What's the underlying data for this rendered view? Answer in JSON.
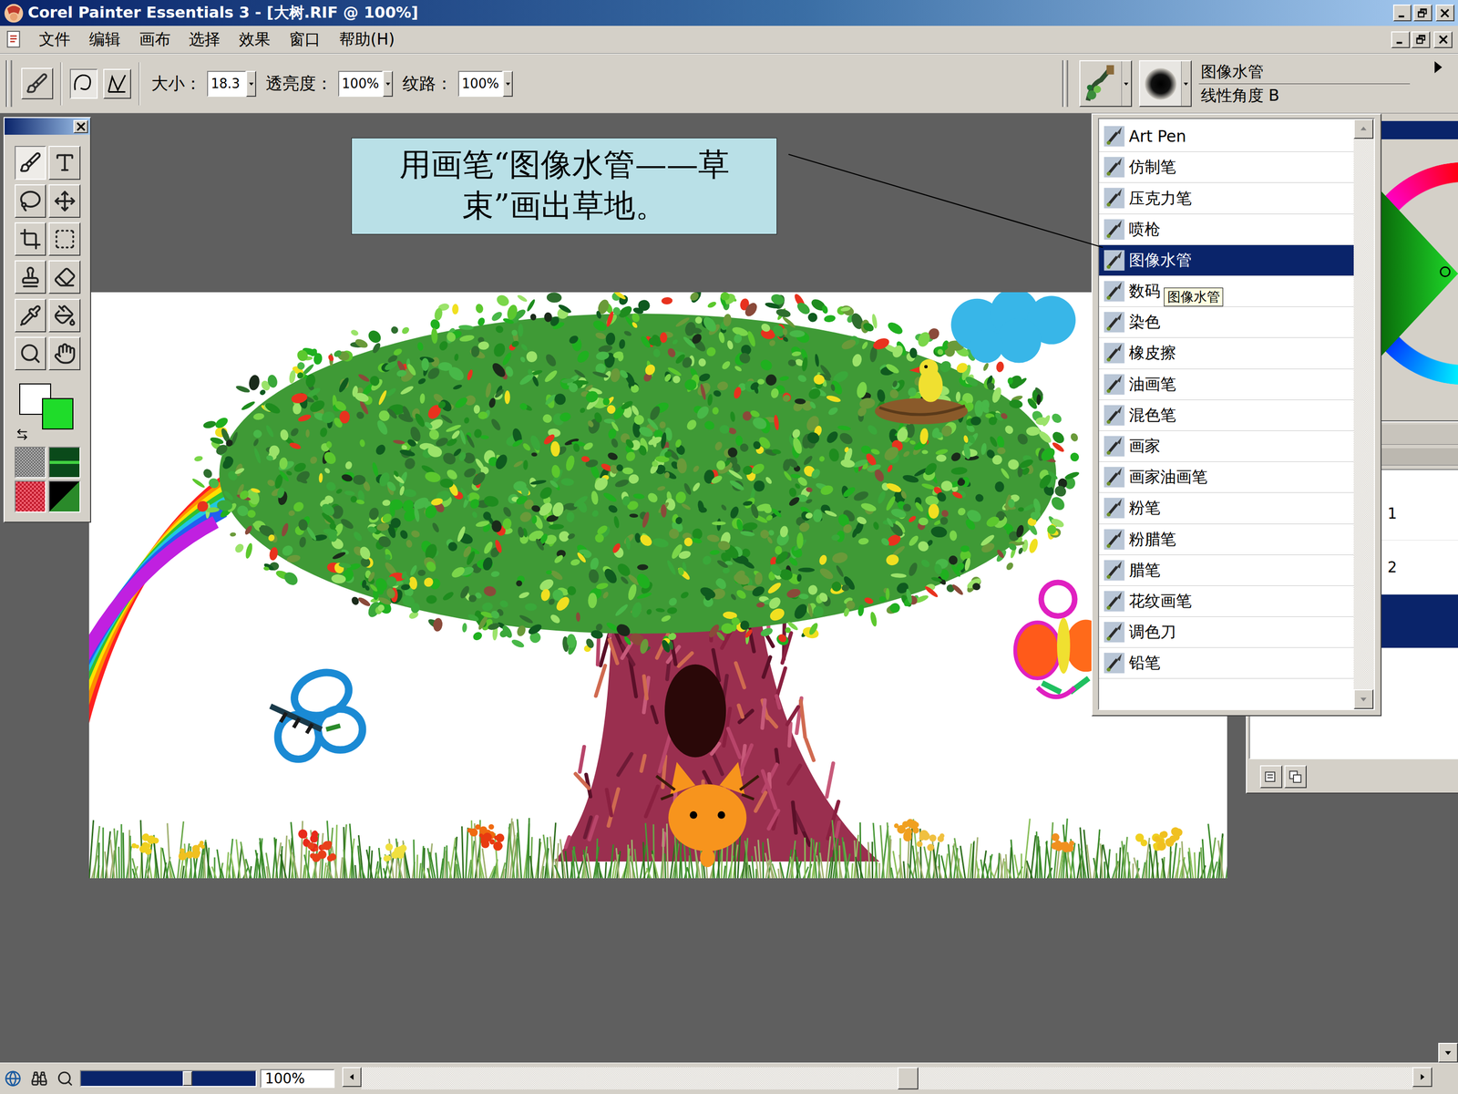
{
  "window": {
    "title": "Corel Painter Essentials 3 - [大树.RIF @ 100%]"
  },
  "menu": [
    "文件",
    "编辑",
    "画布",
    "选择",
    "效果",
    "窗口",
    "帮助(H)"
  ],
  "property_bar": {
    "fields": [
      {
        "label": "大小：",
        "value": "18.3"
      },
      {
        "label": "透亮度：",
        "value": "100%"
      },
      {
        "label": "纹路：",
        "value": "100%"
      }
    ],
    "stroke_modes": [
      {
        "kind": "freehand",
        "selected": true
      },
      {
        "kind": "straight",
        "selected": false
      }
    ],
    "brush_category": "图像水管",
    "brush_variant": "线性角度 B"
  },
  "toolbox": {
    "tools": [
      {
        "kind": "brush",
        "selected": true
      },
      {
        "kind": "text",
        "selected": false
      },
      {
        "kind": "lasso",
        "selected": false
      },
      {
        "kind": "move",
        "selected": false
      },
      {
        "kind": "crop",
        "selected": false
      },
      {
        "kind": "select",
        "selected": false
      },
      {
        "kind": "clone",
        "selected": false
      },
      {
        "kind": "eraser",
        "selected": false
      },
      {
        "kind": "dropper",
        "selected": false
      },
      {
        "kind": "bucket",
        "selected": false
      },
      {
        "kind": "zoom",
        "selected": false
      },
      {
        "kind": "hand",
        "selected": false
      }
    ],
    "main_color": "#1fdc2a",
    "secondary_color": "#ffffff"
  },
  "brush_list": {
    "items": [
      {
        "label": "Art Pen",
        "selected": false,
        "hovered": false
      },
      {
        "label": "仿制笔",
        "selected": false,
        "hovered": false
      },
      {
        "label": "压克力笔",
        "selected": false,
        "hovered": false
      },
      {
        "label": "喷枪",
        "selected": false,
        "hovered": false
      },
      {
        "label": "图像水管",
        "selected": true,
        "hovered": false
      },
      {
        "label": "数码",
        "selected": false,
        "hovered": true
      },
      {
        "label": "染色",
        "selected": false,
        "hovered": false
      },
      {
        "label": "橡皮擦",
        "selected": false,
        "hovered": false
      },
      {
        "label": "油画笔",
        "selected": false,
        "hovered": false
      },
      {
        "label": "混色笔",
        "selected": false,
        "hovered": false
      },
      {
        "label": "画家",
        "selected": false,
        "hovered": false
      },
      {
        "label": "画家油画笔",
        "selected": false,
        "hovered": false
      },
      {
        "label": "粉笔",
        "selected": false,
        "hovered": false
      },
      {
        "label": "粉腊笔",
        "selected": false,
        "hovered": false
      },
      {
        "label": "腊笔",
        "selected": false,
        "hovered": false
      },
      {
        "label": "花纹画笔",
        "selected": false,
        "hovered": false
      },
      {
        "label": "调色刀",
        "selected": false,
        "hovered": false
      },
      {
        "label": "铅笔",
        "selected": false,
        "hovered": false
      }
    ],
    "tooltip": "图像水管"
  },
  "callout": "用画笔“图像水管——草束”画出草地。",
  "layers": [
    {
      "label": "1",
      "selected": false
    },
    {
      "label": "2",
      "selected": false
    },
    {
      "label": "",
      "selected": true
    }
  ],
  "status_bar": {
    "zoom": "100%",
    "zoom_level": 0.61,
    "scroll_position": 0.52
  }
}
